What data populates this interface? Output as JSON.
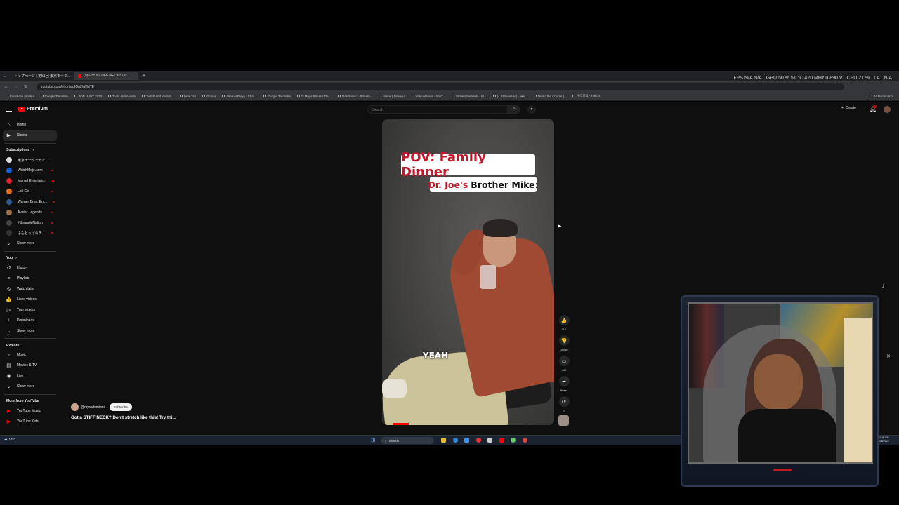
{
  "browser": {
    "tabs": [
      {
        "label": "トップページ | 第51回 東京モータ..."
      },
      {
        "label": "(9) Got a STIFF NECK? Do..."
      }
    ],
    "new_tab": "+",
    "url": "youtube.com/shorts/dfQn2hWNTE",
    "bookmarks": [
      "Facebook profiles",
      "Google Translate",
      "JOB HUNT 2023",
      "Tools and Assets",
      "Twitch and Youtub...",
      "New Tab",
      "Ocular",
      "Akamai Plays - Chat...",
      "Google Translate",
      "O Mayo Stream Thu...",
      "Dashboard - Stream...",
      "Home | Disney+",
      "Video details - YouT...",
      "StreamElements - M...",
      "(4,410 unread) - aka...",
      "Demo the Course |...",
      "구리명의 - Twitch",
      "All Bookmarks"
    ],
    "perf": {
      "fps": "FPS N/A N/A",
      "gpu": "GPU 50 % 51 °C 420 MHz 0.890 V",
      "cpu": "CPU 21 %",
      "lat": "LAT N/A"
    }
  },
  "youtube": {
    "logo": "Premium",
    "search_placeholder": "Search",
    "create": "Create",
    "sidebar": {
      "top": [
        {
          "icon": "home-icon",
          "glyph": "⌂",
          "label": "Home"
        },
        {
          "icon": "shorts-icon",
          "glyph": "▶",
          "label": "Shorts"
        }
      ],
      "subscriptions_title": "Subscriptions",
      "subscriptions": [
        {
          "label": "東京モーターサイ...",
          "color": "#ddd"
        },
        {
          "label": "WatchMojo.com",
          "color": "#1a5fd1"
        },
        {
          "label": "Marvel Entertain...",
          "color": "#e0202a"
        },
        {
          "label": "Lofi Girl",
          "color": "#e07020"
        },
        {
          "label": "Warner Bros. Ent...",
          "color": "#2a5a9a"
        },
        {
          "label": "Avatar Legends",
          "color": "#a07040"
        },
        {
          "label": "#StruggleNation",
          "color": "#444"
        },
        {
          "label": "ふもとっぱらチ...",
          "color": "#333"
        }
      ],
      "show_more": "Show more",
      "you_title": "You",
      "you": [
        {
          "icon": "history-icon",
          "glyph": "↺",
          "label": "History"
        },
        {
          "icon": "playlists-icon",
          "glyph": "≡",
          "label": "Playlists"
        },
        {
          "icon": "watch-later-icon",
          "glyph": "◷",
          "label": "Watch later"
        },
        {
          "icon": "liked-icon",
          "glyph": "👍",
          "label": "Liked videos"
        },
        {
          "icon": "your-videos-icon",
          "glyph": "▷",
          "label": "Your videos"
        },
        {
          "icon": "downloads-icon",
          "glyph": "↓",
          "label": "Downloads"
        }
      ],
      "you_show_more": "Show more",
      "explore_title": "Explore",
      "explore": [
        {
          "icon": "music-icon",
          "glyph": "♪",
          "label": "Music"
        },
        {
          "icon": "movies-icon",
          "glyph": "▤",
          "label": "Movies & TV"
        },
        {
          "icon": "live-icon",
          "glyph": "◉",
          "label": "Live"
        }
      ],
      "explore_show_more": "Show more",
      "more_title": "More from YouTube",
      "more": [
        {
          "label": "YouTube Music"
        },
        {
          "label": "YouTube Kids"
        }
      ]
    },
    "short": {
      "title_line1": "POV: Family Dinner",
      "title_line2_red": "Dr. Joe's",
      "title_line2": "Brother Mike:",
      "caption": "YEAH",
      "progress": 0.09,
      "actions": [
        {
          "icon": "like-icon",
          "glyph": "👍",
          "label": "31K"
        },
        {
          "icon": "dislike-icon",
          "glyph": "👎",
          "label": "Dislike"
        },
        {
          "icon": "comment-icon",
          "glyph": "▭",
          "label": "442"
        },
        {
          "icon": "share-icon",
          "glyph": "➦",
          "label": "Share"
        },
        {
          "icon": "remix-icon",
          "glyph": "⟳",
          "label": "1"
        }
      ],
      "channel": "@drjoedamiani",
      "subscribe": "Subscribe",
      "video_title": "Got a STIFF NECK? Don't stretch like this! Try thi..."
    }
  },
  "taskbar": {
    "weather": "13°C",
    "search": "Search",
    "time": "6:36 PM",
    "date": "9/26/2024"
  }
}
